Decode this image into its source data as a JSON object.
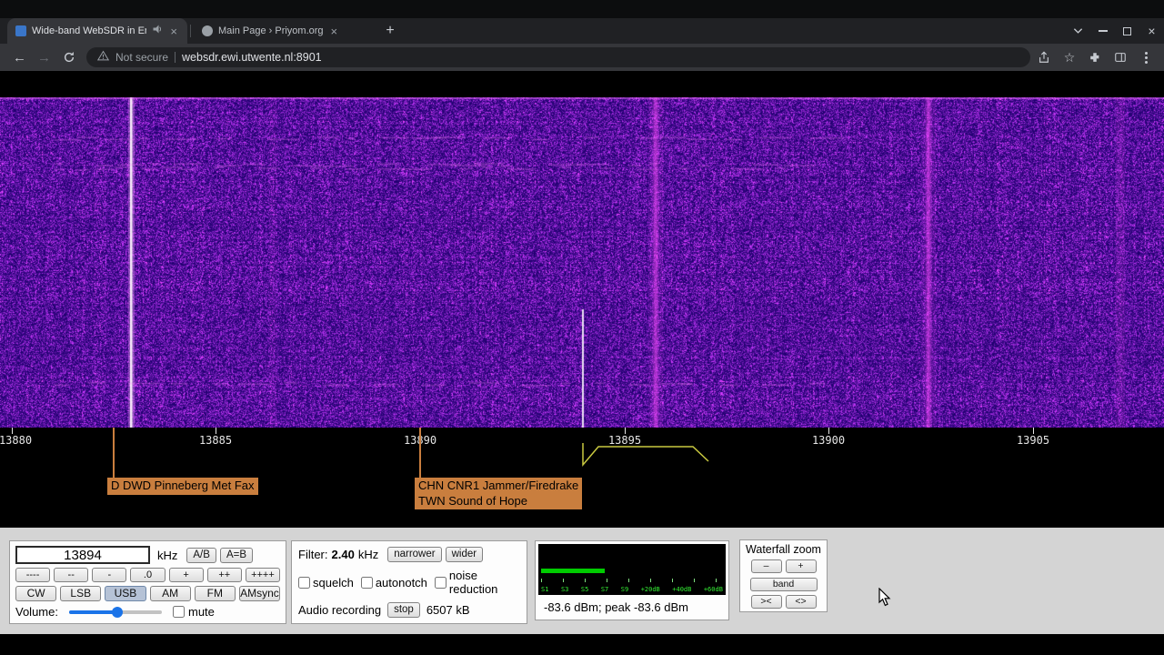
{
  "browser": {
    "tab1_title": "Wide-band WebSDR in Ensch",
    "tab2_title": "Main Page › Priyom.org",
    "new_tab": "+",
    "security_label": "Not secure",
    "url": "websdr.ewi.utwente.nl:8901"
  },
  "icons": {
    "close": "×",
    "star": "☆",
    "back": "←",
    "forward": "→"
  },
  "scale_ticks": [
    "13880",
    "13885",
    "13890",
    "13895",
    "13900",
    "13905"
  ],
  "stations": [
    {
      "lines": [
        "D DWD Pinneberg Met Fax"
      ]
    },
    {
      "lines": [
        "CHN CNR1 Jammer/Firedrake",
        "TWN Sound of Hope"
      ]
    }
  ],
  "tuner": {
    "frequency": "13894",
    "unit": "kHz",
    "ab": "A/B",
    "a_eq_b": "A=B",
    "steps": [
      "----",
      "--",
      "-",
      ".0",
      "+",
      "++",
      "++++"
    ],
    "modes": [
      "CW",
      "LSB",
      "USB",
      "AM",
      "FM",
      "AMsync"
    ],
    "active_mode": "USB",
    "volume_label": "Volume:",
    "mute_label": "mute"
  },
  "filter": {
    "label": "Filter:",
    "value": "2.40",
    "unit": "kHz",
    "narrower": "narrower",
    "wider": "wider",
    "squelch_label": "squelch",
    "autonotch_label": "autonotch",
    "noise_reduction_label": "noise reduction",
    "recording_label": "Audio recording",
    "stop": "stop",
    "recorded_size": "6507 kB"
  },
  "smeter": {
    "scale": [
      "S1",
      "S3",
      "S5",
      "S7",
      "S9",
      "+20dB",
      "+40dB",
      "+60dB"
    ],
    "reading": "-83.6 dBm; peak -83.6 dBm"
  },
  "waterfall_zoom": {
    "title": "Waterfall zoom",
    "minus": "–",
    "plus": "+",
    "band": "band",
    "zoom_in": "><",
    "zoom_out": "<>"
  },
  "colors": {
    "chrome_dark": "#202124",
    "toolbar_gray": "#35363a",
    "accent_blue": "#1a73e8",
    "station_label_orange": "#c97e3e",
    "passband_yellow": "#c9c940",
    "meter_green": "#00cc00",
    "waterfall_purple": "#4b10a8"
  }
}
